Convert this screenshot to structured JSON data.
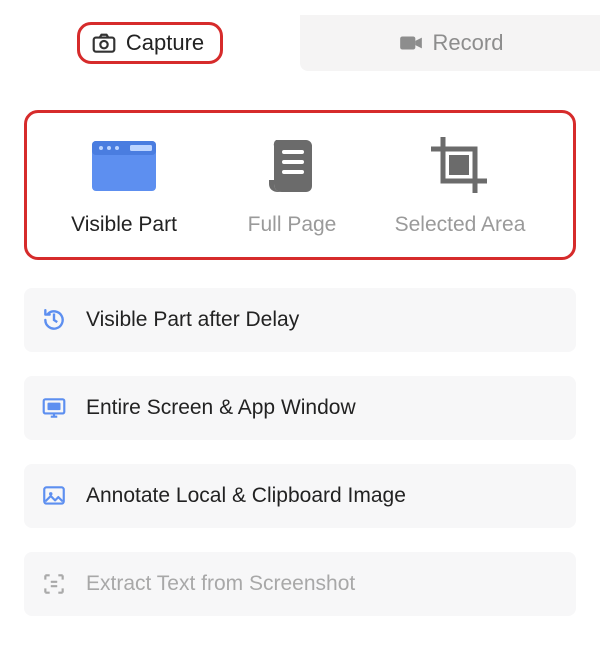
{
  "tabs": {
    "capture": "Capture",
    "record": "Record"
  },
  "modes": {
    "visible_part": "Visible Part",
    "full_page": "Full Page",
    "selected_area": "Selected Area"
  },
  "items": {
    "delay": "Visible Part after Delay",
    "entire": "Entire Screen & App Window",
    "annotate": "Annotate Local & Clipboard Image",
    "extract": "Extract Text from Screenshot"
  },
  "colors": {
    "accent_blue": "#5d8ff0",
    "highlight_red": "#d62b2b",
    "muted": "#9a9a9a"
  }
}
